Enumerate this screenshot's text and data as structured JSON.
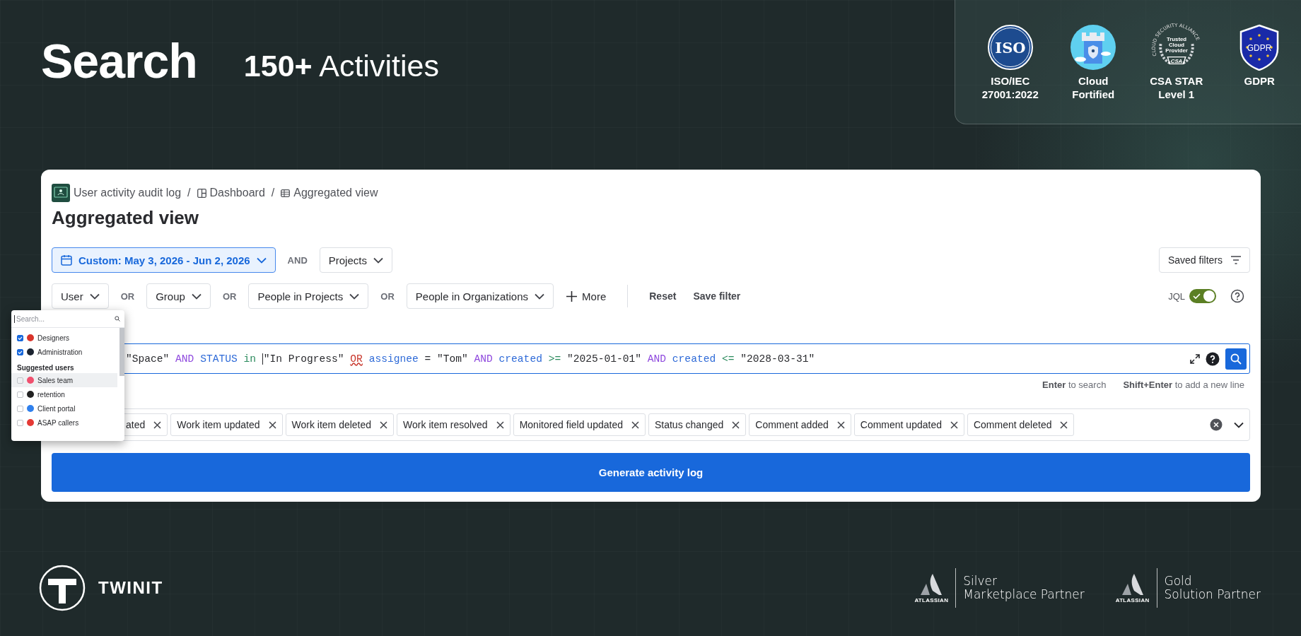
{
  "hero": {
    "title": "Search",
    "subtitle": "**150+** Activities"
  },
  "certifications": [
    {
      "kind": "iso",
      "mark": "ISO",
      "lines": [
        "ISO/IEC",
        "27001:2022"
      ]
    },
    {
      "kind": "cloud",
      "lines": [
        "Cloud",
        "Fortified"
      ]
    },
    {
      "kind": "csa",
      "arc": "CLOUD SECURITY ALLIANCE",
      "mark_lines": [
        "Trusted",
        "Cloud",
        "Provider"
      ],
      "mark": "CSA",
      "lines": [
        "CSA STAR",
        "Level 1"
      ]
    },
    {
      "kind": "gdpr",
      "mark": "GDPR",
      "lines": [
        "GDPR"
      ]
    }
  ],
  "app": {
    "breadcrumb_separator": "/",
    "breadcrumbs": [
      {
        "kind": "app",
        "label": "User activity audit log"
      },
      {
        "kind": "dashboard",
        "label": "Dashboard"
      },
      {
        "kind": "table",
        "label": "Aggregated view"
      }
    ],
    "title": "Aggregated view",
    "filter_rows": [
      {
        "items": [
          {
            "kind": "date",
            "label": "Custom: May 3, 2026 - Jun 2, 2026",
            "active": true
          },
          {
            "kind": "connector",
            "label": "AND"
          },
          {
            "kind": "dropdown",
            "label": "Projects",
            "active": false
          }
        ]
      },
      {
        "items": [
          {
            "kind": "dropdown",
            "label": "User",
            "active": false
          },
          {
            "kind": "connector",
            "label": "OR"
          },
          {
            "kind": "dropdown",
            "label": "Group",
            "active": false
          },
          {
            "kind": "connector",
            "label": "OR"
          },
          {
            "kind": "dropdown",
            "label": "People in Projects",
            "active": false
          },
          {
            "kind": "connector",
            "label": "OR"
          },
          {
            "kind": "dropdown",
            "label": "People in Organizations",
            "active": false
          },
          {
            "kind": "add",
            "label": "More"
          },
          {
            "kind": "divider"
          },
          {
            "kind": "link",
            "label": "Reset"
          },
          {
            "kind": "link",
            "label": "Save filter"
          }
        ]
      }
    ],
    "saved_filters": "Saved filters",
    "jql_toggle": {
      "label": "JQL",
      "on": true
    },
    "jql": {
      "tokens": [
        {
          "text": "\"Space\"",
          "kind": "string",
          "caret": false
        },
        {
          "text": "AND",
          "kind": "keyword",
          "caret": false
        },
        {
          "text": "STATUS",
          "kind": "field",
          "caret": false
        },
        {
          "text": "in",
          "kind": "operator",
          "caret": false
        },
        {
          "text": "\"In Progress\"",
          "kind": "string",
          "caret": true
        },
        {
          "text": "OR",
          "kind": "error",
          "caret": false
        },
        {
          "text": "assignee",
          "kind": "field",
          "caret": false
        },
        {
          "text": "=",
          "kind": "plain",
          "caret": false
        },
        {
          "text": "\"Tom\"",
          "kind": "string",
          "caret": false
        },
        {
          "text": "AND",
          "kind": "keyword",
          "caret": false
        },
        {
          "text": "created",
          "kind": "field",
          "caret": false
        },
        {
          "text": ">=",
          "kind": "operator",
          "caret": false
        },
        {
          "text": "\"2025-01-01\"",
          "kind": "string",
          "caret": false
        },
        {
          "text": "AND",
          "kind": "keyword",
          "caret": false
        },
        {
          "text": "created",
          "kind": "field",
          "caret": false
        },
        {
          "text": "<=",
          "kind": "operator",
          "caret": false
        },
        {
          "text": "\"2028-03-31\"",
          "kind": "string",
          "caret": false
        }
      ],
      "hints": [
        "**Enter** to search",
        "**Shift+Enter** to add a new line"
      ]
    },
    "events": [
      "ated",
      "Work item updated",
      "Work item deleted",
      "Work item resolved",
      "Monitored field updated",
      "Status changed",
      "Comment added",
      "Comment updated",
      "Comment deleted"
    ],
    "generate_button": "Generate activity log"
  },
  "user_dropdown": {
    "placeholder": "Search...",
    "selected_users": [
      {
        "label": "Designers",
        "checked": true,
        "hovered": false,
        "color": "#d9342b"
      },
      {
        "label": "Administration",
        "checked": true,
        "hovered": false,
        "color": "#1b2330"
      }
    ],
    "suggested_heading": "Suggested users",
    "suggested_users": [
      {
        "label": "Sales team",
        "checked": false,
        "hovered": true,
        "color": "#f0506e"
      },
      {
        "label": "retention",
        "checked": false,
        "hovered": false,
        "color": "#222222"
      },
      {
        "label": "Client portal",
        "checked": false,
        "hovered": false,
        "color": "#2f80ed"
      },
      {
        "label": "ASAP callers",
        "checked": false,
        "hovered": false,
        "color": "#e53935"
      }
    ]
  },
  "footer": {
    "brand": "TWINIT",
    "partners": [
      {
        "logo_text": "ATLASSIAN",
        "tier": "Silver",
        "program": "Marketplace Partner"
      },
      {
        "logo_text": "ATLASSIAN",
        "tier": "Gold",
        "program": "Solution Partner"
      }
    ]
  }
}
